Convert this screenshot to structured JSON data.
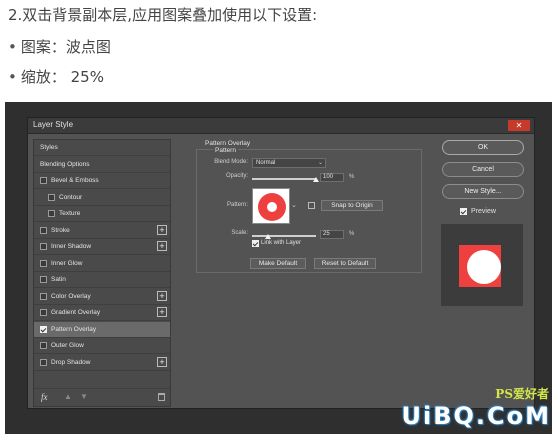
{
  "instructions": {
    "heading": "2.双击背景副本层,应用图案叠加使用以下设置:",
    "bullets": [
      {
        "marker": "•",
        "text": "图案：波点图"
      },
      {
        "marker": "•",
        "text": "缩放： 25%"
      }
    ]
  },
  "dialog": {
    "title": "Layer Style",
    "close_icon": "close-icon",
    "style_list": [
      {
        "label": "Styles",
        "checkbox": false,
        "checked": false,
        "indent": 0,
        "plus": false,
        "selected": false
      },
      {
        "label": "Blending Options",
        "checkbox": false,
        "checked": false,
        "indent": 0,
        "plus": false,
        "selected": false
      },
      {
        "label": "Bevel & Emboss",
        "checkbox": true,
        "checked": false,
        "indent": 0,
        "plus": false,
        "selected": false
      },
      {
        "label": "Contour",
        "checkbox": true,
        "checked": false,
        "indent": 1,
        "plus": false,
        "selected": false
      },
      {
        "label": "Texture",
        "checkbox": true,
        "checked": false,
        "indent": 1,
        "plus": false,
        "selected": false
      },
      {
        "label": "Stroke",
        "checkbox": true,
        "checked": false,
        "indent": 0,
        "plus": true,
        "selected": false
      },
      {
        "label": "Inner Shadow",
        "checkbox": true,
        "checked": false,
        "indent": 0,
        "plus": true,
        "selected": false
      },
      {
        "label": "Inner Glow",
        "checkbox": true,
        "checked": false,
        "indent": 0,
        "plus": false,
        "selected": false
      },
      {
        "label": "Satin",
        "checkbox": true,
        "checked": false,
        "indent": 0,
        "plus": false,
        "selected": false
      },
      {
        "label": "Color Overlay",
        "checkbox": true,
        "checked": false,
        "indent": 0,
        "plus": true,
        "selected": false
      },
      {
        "label": "Gradient Overlay",
        "checkbox": true,
        "checked": false,
        "indent": 0,
        "plus": true,
        "selected": false
      },
      {
        "label": "Pattern Overlay",
        "checkbox": true,
        "checked": true,
        "indent": 0,
        "plus": false,
        "selected": true
      },
      {
        "label": "Outer Glow",
        "checkbox": true,
        "checked": false,
        "indent": 0,
        "plus": false,
        "selected": false
      },
      {
        "label": "Drop Shadow",
        "checkbox": true,
        "checked": false,
        "indent": 0,
        "plus": true,
        "selected": false
      }
    ],
    "list_footer": {
      "fx_label": "fx",
      "up_icon": "arrow-up-icon",
      "down_icon": "arrow-down-icon",
      "trash_icon": "trash-icon"
    },
    "panel": {
      "section_title": "Pattern Overlay",
      "group_title": "Pattern",
      "blend_mode_label": "Blend Mode:",
      "blend_mode_value": "Normal",
      "opacity_label": "Opacity:",
      "opacity_value": "100",
      "opacity_unit": "%",
      "opacity_fraction": 1.0,
      "pattern_label": "Pattern:",
      "snap_to_origin": "Snap to Origin",
      "scale_label": "Scale:",
      "scale_value": "25",
      "scale_unit": "%",
      "scale_fraction": 0.25,
      "link_with_layer": "Link with Layer",
      "link_checked": true,
      "make_default": "Make Default",
      "reset_to_default": "Reset to Default"
    },
    "right": {
      "ok": "OK",
      "cancel": "Cancel",
      "new_style": "New Style...",
      "preview": "Preview",
      "preview_checked": true
    },
    "colors": {
      "accent_red": "#ef4040",
      "dialog_bg": "#535353"
    }
  },
  "watermark": {
    "main": "UiBQ.CoM",
    "sub": "PS爱好者"
  }
}
